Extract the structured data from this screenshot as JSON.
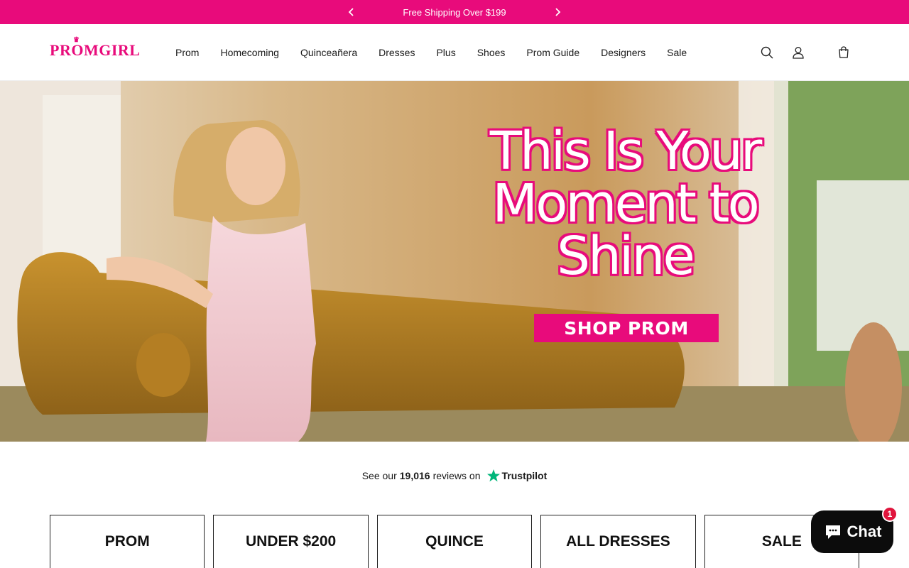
{
  "announcement": {
    "text": "Free Shipping Over $199"
  },
  "header": {
    "logo": "PROMGIRL",
    "nav": [
      "Prom",
      "Homecoming",
      "Quinceañera",
      "Dresses",
      "Plus",
      "Shoes",
      "Prom Guide",
      "Designers",
      "Sale"
    ]
  },
  "hero": {
    "headline_line1": "This Is Your",
    "headline_line2": "Moment to",
    "headline_line3": "Shine",
    "cta": "SHOP PROM"
  },
  "trustpilot": {
    "prefix": "See our",
    "count": "19,016",
    "suffix": "reviews on",
    "brand": "Trustpilot"
  },
  "categories": [
    "PROM",
    "UNDER $200",
    "QUINCE",
    "ALL DRESSES",
    "SALE"
  ],
  "chat": {
    "label": "Chat",
    "badge": "1"
  },
  "colors": {
    "brand_pink": "#e80b7b",
    "chat_bg": "#0c0c0c",
    "badge_red": "#e0143c",
    "trustpilot_green": "#00b67a"
  },
  "icons": [
    "chevron-left-icon",
    "chevron-right-icon",
    "search-icon",
    "account-icon",
    "cart-icon",
    "chat-bubble-icon",
    "trustpilot-star-icon"
  ]
}
